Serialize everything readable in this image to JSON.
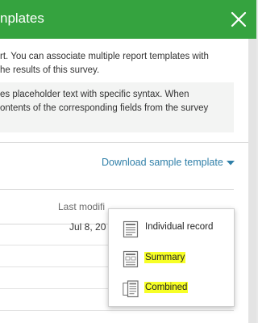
{
  "header": {
    "title": "nplates"
  },
  "description": {
    "line1": "rt. You can associate multiple report templates with",
    "line2": "he results of this survey."
  },
  "info": {
    "line1": "es placeholder text with specific syntax. When",
    "line2": "ontents of the corresponding fields from the survey"
  },
  "download": {
    "label": "Download sample template"
  },
  "table": {
    "column_last_modified": "Last modifi",
    "rows": [
      {
        "date": "Jul 8, 20"
      }
    ]
  },
  "dropdown": {
    "items": [
      {
        "label": "Individual record",
        "icon": "single-record-icon",
        "highlighted": false
      },
      {
        "label": "Summary",
        "icon": "summary-icon",
        "highlighted": true
      },
      {
        "label": "Combined",
        "icon": "combined-icon",
        "highlighted": true
      }
    ]
  },
  "colors": {
    "header": "#35a33f",
    "link": "#2f7fa8",
    "highlight": "#f7ff26"
  }
}
